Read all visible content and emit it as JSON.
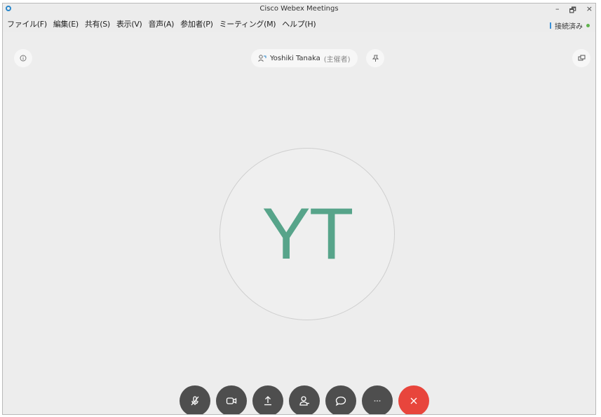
{
  "window": {
    "title": "Cisco Webex Meetings",
    "controls": {
      "minimize": "–",
      "restore": "🗗",
      "close": "×"
    }
  },
  "menu": [
    {
      "label": "ファイル(F)"
    },
    {
      "label": "編集(E)"
    },
    {
      "label": "共有(S)"
    },
    {
      "label": "表示(V)"
    },
    {
      "label": "音声(A)"
    },
    {
      "label": "参加者(P)"
    },
    {
      "label": "ミーティング(M)"
    },
    {
      "label": "ヘルプ(H)"
    }
  ],
  "status": {
    "label": "接続済み",
    "color": "#5fb34d"
  },
  "host": {
    "name": "Yoshiki Tanaka",
    "role": "(主催者)"
  },
  "avatar": {
    "initials": "YT",
    "color": "#57a48a"
  },
  "controls": [
    {
      "name": "mute",
      "icon": "microphone-muted-icon"
    },
    {
      "name": "video",
      "icon": "video-camera-icon"
    },
    {
      "name": "share",
      "icon": "share-upload-icon"
    },
    {
      "name": "participants",
      "icon": "participants-icon"
    },
    {
      "name": "chat",
      "icon": "chat-bubble-icon"
    },
    {
      "name": "more",
      "icon": "more-icon"
    },
    {
      "name": "leave",
      "icon": "close-icon",
      "color": "#e8453c"
    }
  ]
}
